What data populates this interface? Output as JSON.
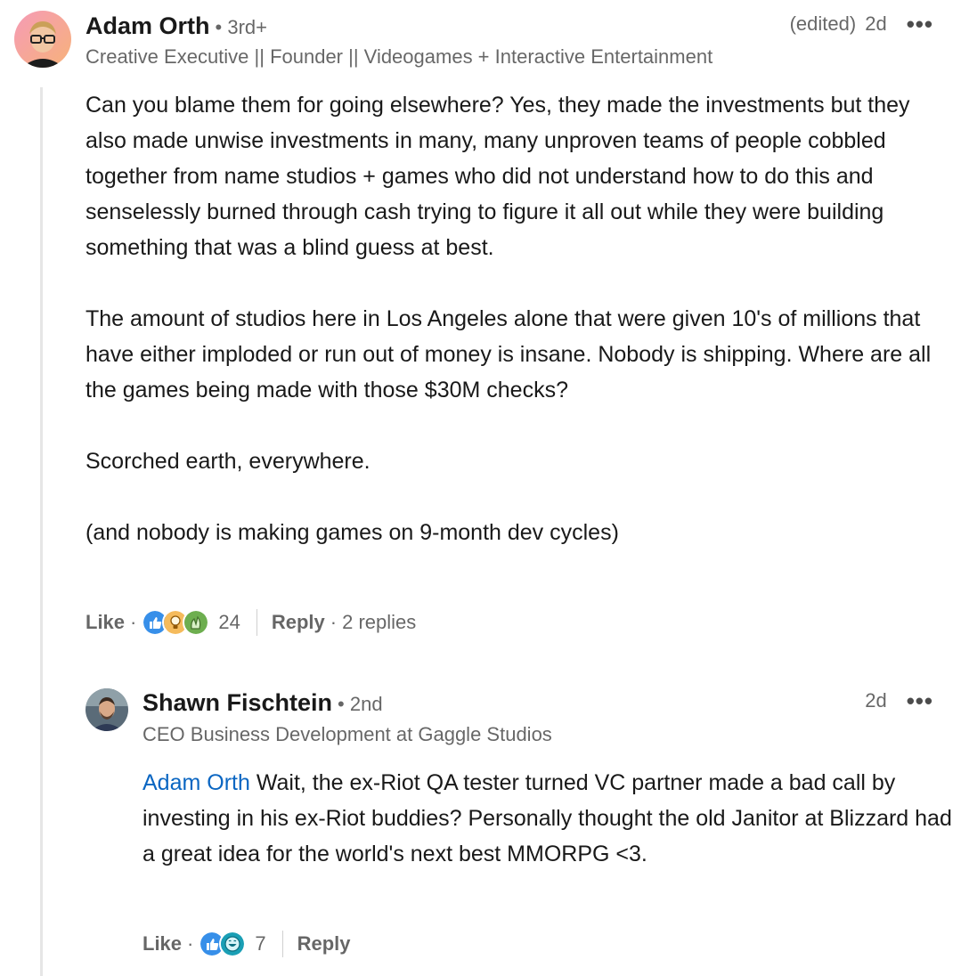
{
  "comment": {
    "author": "Adam Orth",
    "degree": "• 3rd+",
    "headline": "Creative Executive || Founder || Videogames + Interactive Entertainment",
    "edited": "(edited)",
    "time": "2d",
    "more": "•••",
    "paragraphs": [
      "Can you blame them for going elsewhere? Yes, they made the investments but they also made unwise investments in many, many unproven teams of people cobbled together from name studios + games who did not understand how to do this and senselessly burned through cash trying to figure it all out while they were building something that was a blind guess at best.",
      "The amount of studios here in Los Angeles alone that were given 10's of millions that have either imploded or run out of money is insane. Nobody is shipping. Where are all the games being made with those $30M checks?",
      "Scorched earth, everywhere.",
      "(and nobody is making games on 9-month dev cycles)"
    ],
    "like_label": "Like",
    "sep": "·",
    "reaction_icons": [
      "like-reaction-icon",
      "insightful-reaction-icon",
      "celebrate-reaction-icon"
    ],
    "reaction_count": "24",
    "reply_label": "Reply",
    "replies_text": "2 replies"
  },
  "reply": {
    "author": "Shawn Fischtein",
    "degree": "• 2nd",
    "headline": "CEO Business Development at Gaggle Studios",
    "time": "2d",
    "more": "•••",
    "mention": "Adam Orth",
    "text": " Wait, the ex-Riot QA tester turned VC partner made a bad call by investing in his ex-Riot buddies? Personally thought the old Janitor at Blizzard had a great idea for the world's next best MMORPG <3.",
    "like_label": "Like",
    "sep": "·",
    "reaction_icons": [
      "like-reaction-icon",
      "funny-reaction-icon"
    ],
    "reaction_count": "7",
    "reply_label": "Reply"
  },
  "colors": {
    "link_blue": "#0a66c2",
    "like_blue": "#378fe9",
    "insightful_yellow": "#f5bb5c",
    "celebrate_green": "#44712e",
    "funny_teal": "#1a9fb5"
  }
}
